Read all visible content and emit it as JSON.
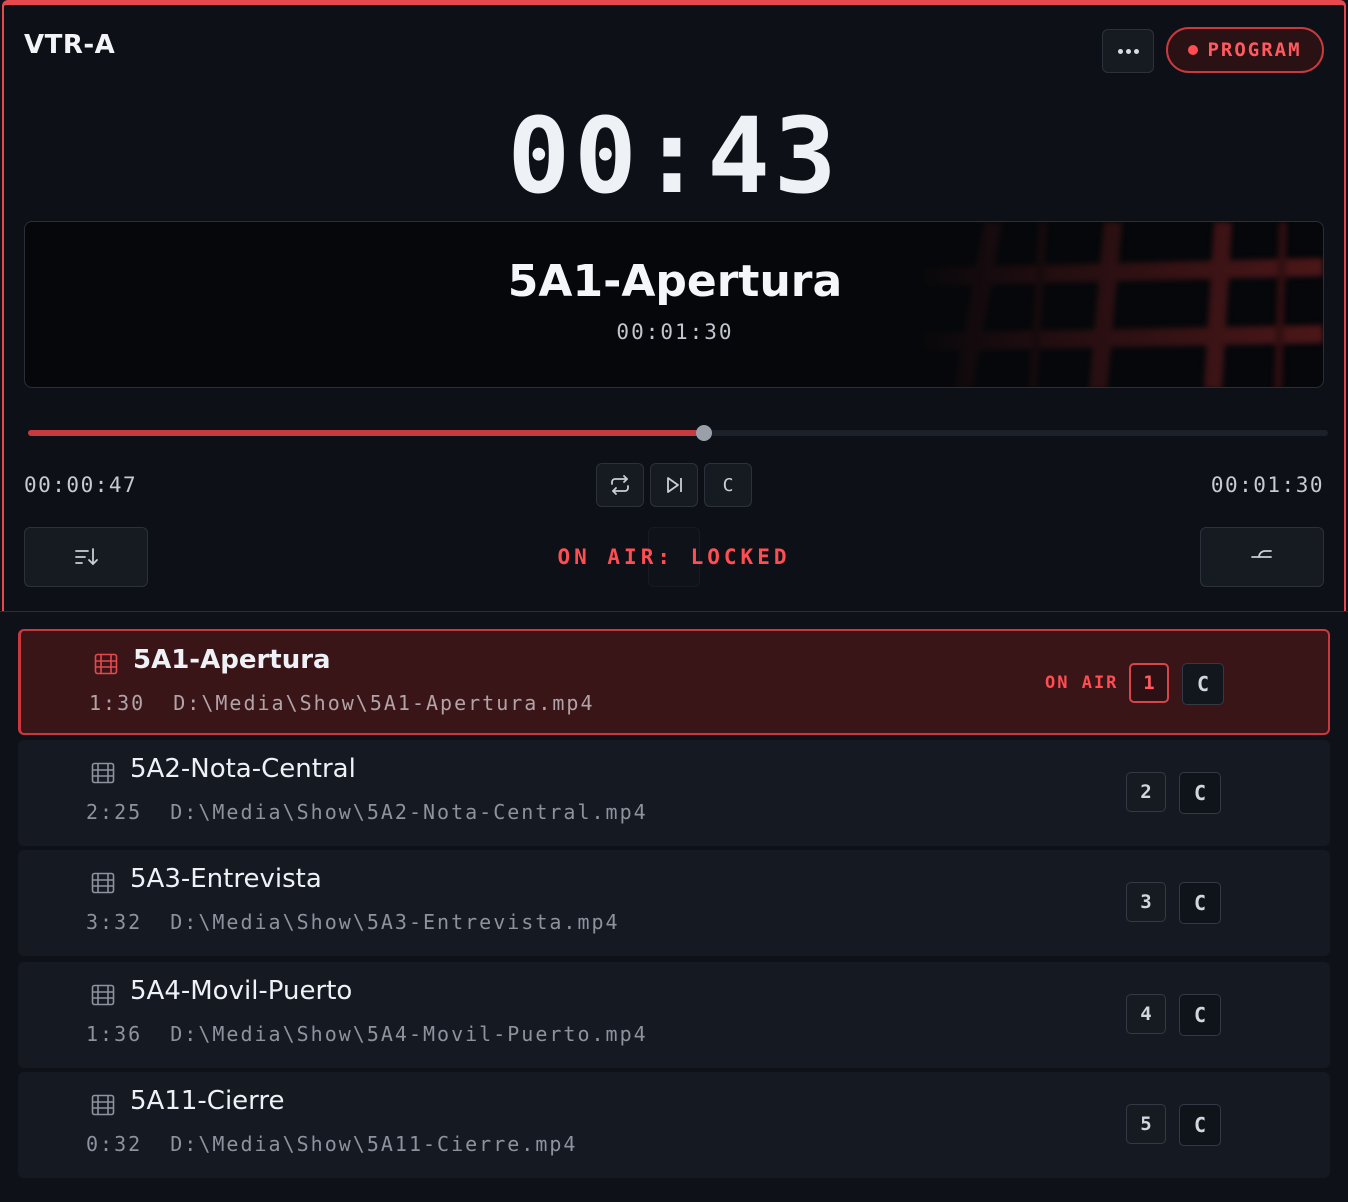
{
  "header": {
    "title": "VTR-A",
    "more_icon": "ellipsis-icon",
    "program_label": "PROGRAM",
    "program_icon": "record-dot-icon"
  },
  "countdown": "00:43",
  "preview": {
    "clip_title": "5A1-Apertura",
    "clip_duration": "00:01:30"
  },
  "transport": {
    "progress_fraction": 0.52,
    "elapsed": "00:00:47",
    "total": "00:01:30",
    "loop_icon": "loop-icon",
    "next_icon": "skip-next-icon",
    "cue_label": "C",
    "left_tool_icon": "sort-down-icon",
    "right_tool_icon": "branch-icon",
    "status": "ON AIR: LOCKED"
  },
  "playlist": [
    {
      "name": "5A1-Apertura",
      "duration": "1:30",
      "path": "D:\\Media\\Show\\5A1-Apertura.mp4",
      "number": "1",
      "cue": "C",
      "on_air": "ON AIR",
      "active": true
    },
    {
      "name": "5A2-Nota-Central",
      "duration": "2:25",
      "path": "D:\\Media\\Show\\5A2-Nota-Central.mp4",
      "number": "2",
      "cue": "C",
      "on_air": "",
      "active": false
    },
    {
      "name": "5A3-Entrevista",
      "duration": "3:32",
      "path": "D:\\Media\\Show\\5A3-Entrevista.mp4",
      "number": "3",
      "cue": "C",
      "on_air": "",
      "active": false
    },
    {
      "name": "5A4-Movil-Puerto",
      "duration": "1:36",
      "path": "D:\\Media\\Show\\5A4-Movil-Puerto.mp4",
      "number": "4",
      "cue": "C",
      "on_air": "",
      "active": false
    },
    {
      "name": "5A11-Cierre",
      "duration": "0:32",
      "path": "D:\\Media\\Show\\5A11-Cierre.mp4",
      "number": "5",
      "cue": "C",
      "on_air": "",
      "active": false
    }
  ],
  "colors": {
    "accent_red": "#e5484d",
    "background": "#0d1117",
    "active_row": "#3a1518"
  }
}
